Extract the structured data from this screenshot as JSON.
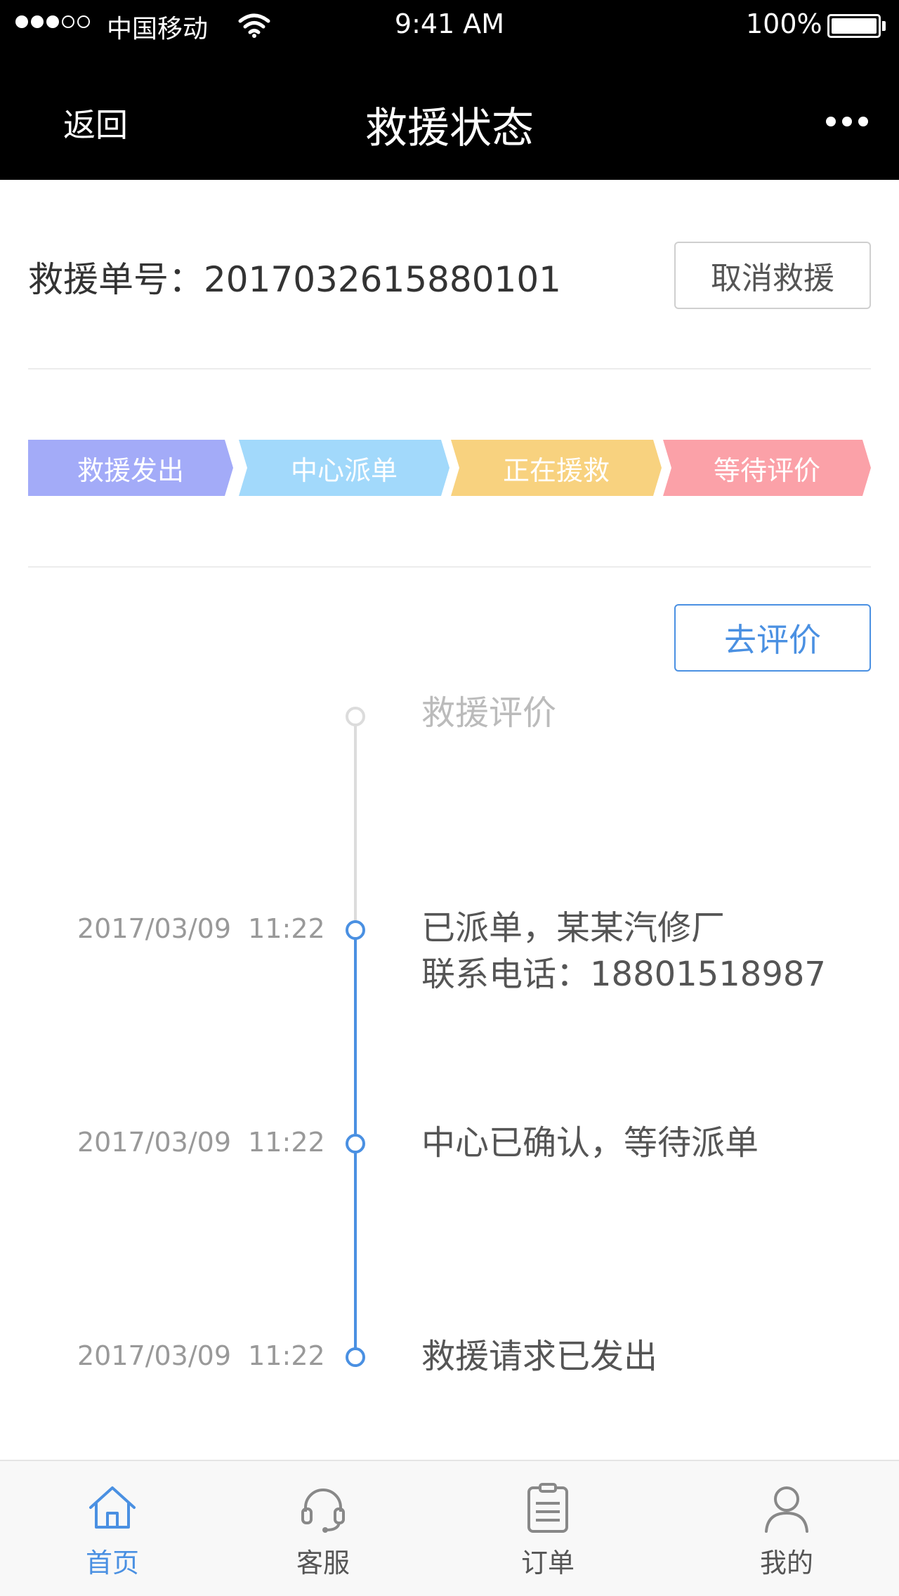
{
  "status_bar": {
    "carrier": "中国移动",
    "time": "9:41 AM",
    "battery": "100%"
  },
  "nav": {
    "back_label": "返回",
    "title": "救援状态",
    "more_icon": "more-dots-icon"
  },
  "order": {
    "label": "救援单号：2017032615880101",
    "cancel_label": "取消救援"
  },
  "steps": [
    {
      "label": "救援发出",
      "color": "#a3abf8"
    },
    {
      "label": "中心派单",
      "color": "#a2d9fb"
    },
    {
      "label": "正在援救",
      "color": "#f8d27f"
    },
    {
      "label": "等待评价",
      "color": "#fba1a8"
    }
  ],
  "evaluate_label": "去评价",
  "timeline": [
    {
      "date": "",
      "text_lines": [
        "救援评价"
      ],
      "state": "pending"
    },
    {
      "date": "2017/03/09  11:22",
      "text_lines": [
        "已派单，某某汽修厂",
        "联系电话：18801518987"
      ],
      "state": "done"
    },
    {
      "date": "2017/03/09  11:22",
      "text_lines": [
        "中心已确认，等待派单"
      ],
      "state": "done"
    },
    {
      "date": "2017/03/09  11:22",
      "text_lines": [
        "救援请求已发出"
      ],
      "state": "done"
    }
  ],
  "tabbar": {
    "items": [
      {
        "label": "首页",
        "icon": "home-icon",
        "active": true
      },
      {
        "label": "客服",
        "icon": "headset-icon",
        "active": false
      },
      {
        "label": "订单",
        "icon": "clipboard-icon",
        "active": false
      },
      {
        "label": "我的",
        "icon": "user-icon",
        "active": false
      }
    ]
  },
  "colors": {
    "accent": "#4a90e2",
    "topbar": "#000000"
  }
}
